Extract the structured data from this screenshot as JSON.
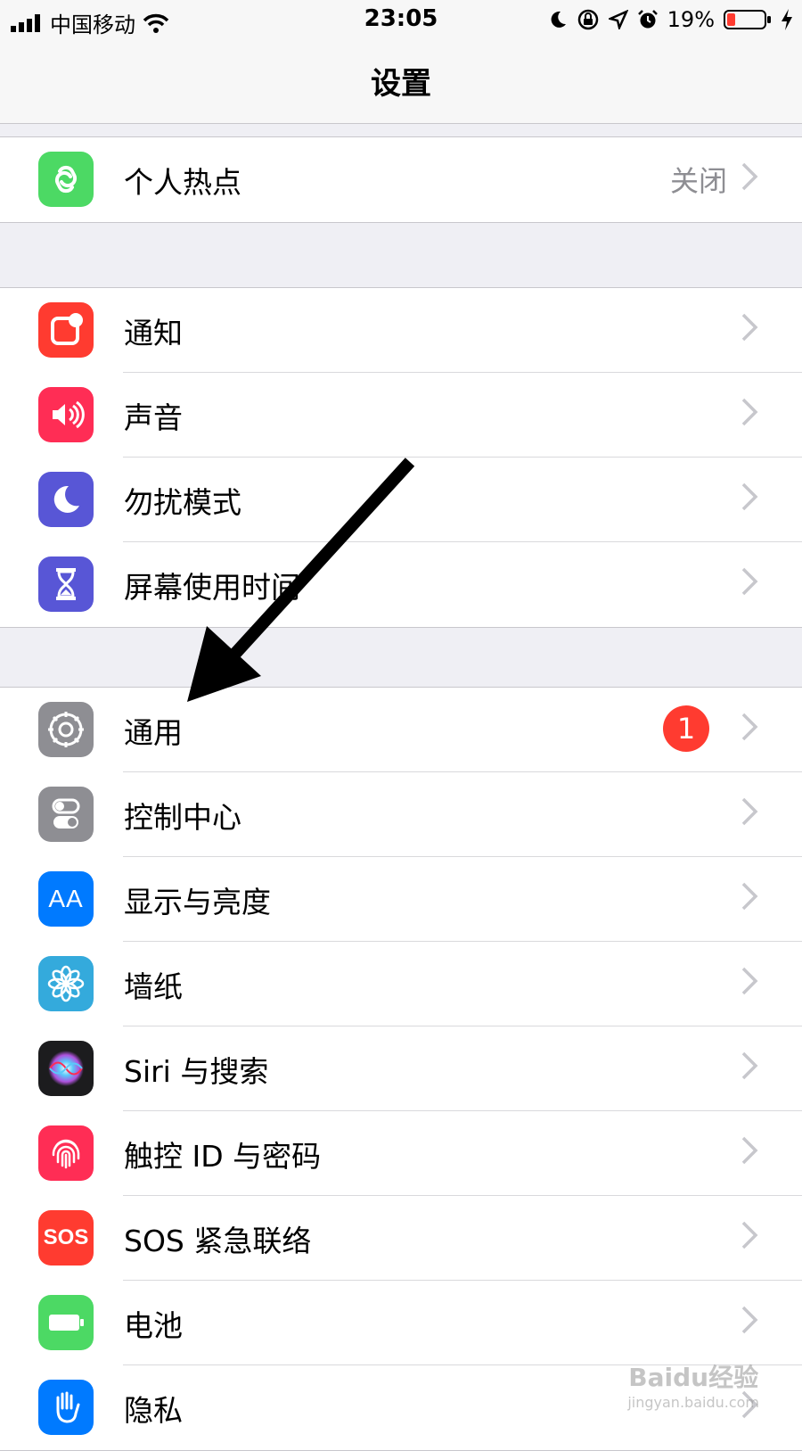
{
  "status": {
    "carrier": "中国移动",
    "time": "23:05",
    "battery": "19%"
  },
  "nav": {
    "title": "设置"
  },
  "colors": {
    "hotspot": "#4cd964",
    "notifications": "#ff3b30",
    "sounds": "#ff2d55",
    "dnd": "#5856d6",
    "screentime": "#5856d6",
    "general": "#8e8e93",
    "control": "#8e8e93",
    "display": "#007aff",
    "wallpaper": "#34aadc",
    "siri": "#1c1c1e",
    "touchid": "#ff2d55",
    "sos": "#ff3b30",
    "battery": "#4cd964",
    "privacy": "#007aff"
  },
  "groups": {
    "g1": {
      "hotspot": {
        "label": "个人热点",
        "value": "关闭"
      }
    },
    "g2": {
      "notifications": "通知",
      "sounds": "声音",
      "dnd": "勿扰模式",
      "screentime": "屏幕使用时间"
    },
    "g3": {
      "general": {
        "label": "通用",
        "badge": "1"
      },
      "control": "控制中心",
      "display": "显示与亮度",
      "wallpaper": "墙纸",
      "siri": "Siri 与搜索",
      "touchid": "触控 ID 与密码",
      "sos": "SOS 紧急联络",
      "battery": "电池",
      "privacy": "隐私"
    }
  },
  "icons": {
    "hotspot": "hotspot-icon",
    "notifications": "notifications-icon",
    "sounds": "sounds-icon",
    "dnd": "moon-icon",
    "screentime": "hourglass-icon",
    "general": "gear-icon",
    "control": "toggles-icon",
    "display": "text-size-icon",
    "wallpaper": "flower-icon",
    "siri": "siri-icon",
    "touchid": "fingerprint-icon",
    "sos": "sos-icon",
    "battery": "battery-icon",
    "privacy": "hand-icon"
  },
  "sos_icon_text": "SOS",
  "display_icon_text": "AA",
  "watermark": {
    "brand": "Baidu经验",
    "url": "jingyan.baidu.com"
  }
}
